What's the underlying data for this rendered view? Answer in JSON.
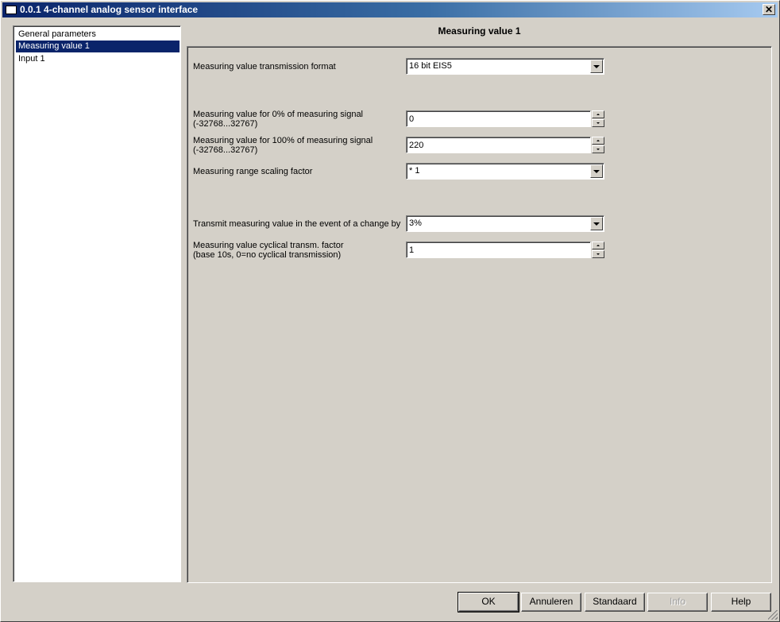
{
  "window": {
    "title": "0.0.1 4-channel analog sensor interface",
    "close_label": "✕"
  },
  "tree": {
    "items": [
      {
        "label": "General parameters",
        "selected": false
      },
      {
        "label": "Measuring value 1",
        "selected": true
      },
      {
        "label": "Input 1",
        "selected": false
      }
    ]
  },
  "panel": {
    "title": "Measuring value 1",
    "transmission_format": {
      "label": "Measuring value transmission format",
      "value": "16 bit EIS5"
    },
    "value_0": {
      "label_line1": "Measuring value for 0% of measuring signal",
      "label_line2": "(-32768...32767)",
      "value": "0"
    },
    "value_100": {
      "label_line1": "Measuring value for 100% of measuring signal",
      "label_line2": "(-32768...32767)",
      "value": "220"
    },
    "scaling": {
      "label": "Measuring range scaling factor",
      "value": "* 1"
    },
    "change": {
      "label": "Transmit measuring value in the event of a change by",
      "value": "3%"
    },
    "cyclical": {
      "label_line1": "Measuring value cyclical transm. factor",
      "label_line2": "(base 10s, 0=no cyclical transmission)",
      "value": "1"
    }
  },
  "buttons": {
    "ok": "OK",
    "cancel": "Annuleren",
    "standard": "Standaard",
    "info": "Info",
    "help": "Help"
  }
}
